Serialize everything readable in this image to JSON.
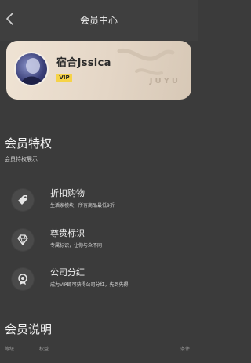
{
  "header": {
    "title": "会员中心"
  },
  "card": {
    "username": "宿合Jssica",
    "vip_badge": "VIP",
    "brand": "JUYU"
  },
  "privileges": {
    "title": "会员特权",
    "subtitle": "会员特权展示",
    "items": [
      {
        "icon": "price-tag-icon",
        "name": "折扣购物",
        "desc": "生活家模块，所有商品最低9折"
      },
      {
        "icon": "diamond-icon",
        "name": "尊贵标识",
        "desc": "专属标识，让你与众不同"
      },
      {
        "icon": "dividend-icon",
        "name": "公司分红",
        "desc": "成为VIP即可获得公司分红，先到先得"
      }
    ]
  },
  "explanation": {
    "title": "会员说明",
    "columns": [
      "等级",
      "权益",
      "条件"
    ]
  }
}
